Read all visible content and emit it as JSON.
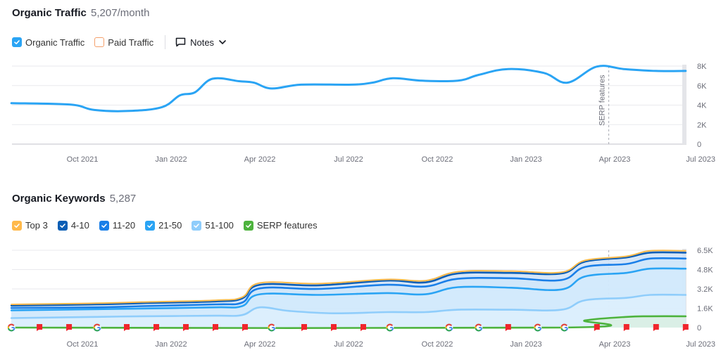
{
  "traffic": {
    "title": "Organic Traffic",
    "value": "5,207/month",
    "legend": [
      {
        "label": "Organic Traffic",
        "checked": true,
        "color": "#2aa4f4"
      },
      {
        "label": "Paid Traffic",
        "checked": false,
        "color": "#f4a06b"
      }
    ],
    "notes_label": "Notes"
  },
  "keywords": {
    "title": "Organic Keywords",
    "value": "5,287",
    "legend": [
      {
        "label": "Top 3",
        "checked": true,
        "color": "#ffb94a"
      },
      {
        "label": "4-10",
        "checked": true,
        "color": "#0b5eb5"
      },
      {
        "label": "11-20",
        "checked": true,
        "color": "#1a7fe8"
      },
      {
        "label": "21-50",
        "checked": true,
        "color": "#2aa4f4"
      },
      {
        "label": "51-100",
        "checked": true,
        "color": "#8fcdfb"
      },
      {
        "label": "SERP features",
        "checked": true,
        "color": "#4db33d"
      }
    ]
  },
  "chart_data": [
    {
      "type": "line",
      "title": "Organic Traffic",
      "x_ticks": [
        "Oct 2021",
        "Jan 2022",
        "Apr 2022",
        "Jul 2022",
        "Oct 2022",
        "Jan 2023",
        "Apr 2023",
        "Jul 2023"
      ],
      "x_range_months": [
        -2.4,
        20.4
      ],
      "y_ticks": [
        "0",
        "2K",
        "4K",
        "6K",
        "8K"
      ],
      "ylim": [
        0,
        8000
      ],
      "grid": true,
      "annotation": {
        "label": "SERP features",
        "month": 17.8
      },
      "series": [
        {
          "name": "Organic Traffic",
          "color": "#2aa4f4",
          "points": [
            [
              -2.4,
              4200
            ],
            [
              -0.4,
              4050
            ],
            [
              0.4,
              3500
            ],
            [
              1.6,
              3400
            ],
            [
              2.7,
              3800
            ],
            [
              3.3,
              5000
            ],
            [
              3.8,
              5300
            ],
            [
              4.4,
              6700
            ],
            [
              5.3,
              6450
            ],
            [
              5.8,
              6300
            ],
            [
              6.4,
              5700
            ],
            [
              7.4,
              6100
            ],
            [
              9.1,
              6100
            ],
            [
              9.8,
              6300
            ],
            [
              10.5,
              6750
            ],
            [
              11.5,
              6500
            ],
            [
              12.7,
              6500
            ],
            [
              13.4,
              7100
            ],
            [
              14.4,
              7700
            ],
            [
              15.6,
              7300
            ],
            [
              16.4,
              6300
            ],
            [
              17.4,
              7950
            ],
            [
              18.3,
              7700
            ],
            [
              19.4,
              7500
            ],
            [
              20.4,
              7500
            ]
          ]
        }
      ]
    },
    {
      "type": "area",
      "title": "Organic Keywords",
      "x_ticks": [
        "Oct 2021",
        "Jan 2022",
        "Apr 2022",
        "Jul 2022",
        "Oct 2022",
        "Jan 2023",
        "Apr 2023",
        "Jul 2023"
      ],
      "x_range_months": [
        -2.4,
        20.4
      ],
      "y_ticks": [
        "0",
        "1.6K",
        "3.2K",
        "4.8K",
        "6.5K"
      ],
      "ylim": [
        0,
        6500
      ],
      "grid": true,
      "series": [
        {
          "name": "Top 3",
          "color": "#ffb94a",
          "points": [
            [
              -2.4,
              1950
            ],
            [
              0.5,
              2050
            ],
            [
              2.0,
              2150
            ],
            [
              4.5,
              2300
            ],
            [
              5.4,
              2550
            ],
            [
              6.0,
              3750
            ],
            [
              8.0,
              3700
            ],
            [
              10.3,
              4050
            ],
            [
              11.6,
              3950
            ],
            [
              12.7,
              4700
            ],
            [
              14.5,
              4750
            ],
            [
              16.2,
              4650
            ],
            [
              17.0,
              5650
            ],
            [
              18.4,
              6000
            ],
            [
              19.2,
              6450
            ],
            [
              20.4,
              6450
            ]
          ]
        },
        {
          "name": "4-10",
          "color": "#0b5eb5",
          "points": [
            [
              -2.4,
              1850
            ],
            [
              0.5,
              1950
            ],
            [
              2.0,
              2050
            ],
            [
              4.5,
              2200
            ],
            [
              5.4,
              2450
            ],
            [
              6.0,
              3600
            ],
            [
              8.0,
              3550
            ],
            [
              10.3,
              3950
            ],
            [
              11.6,
              3800
            ],
            [
              12.7,
              4550
            ],
            [
              14.5,
              4600
            ],
            [
              16.2,
              4550
            ],
            [
              17.0,
              5550
            ],
            [
              18.4,
              5900
            ],
            [
              19.2,
              6300
            ],
            [
              20.4,
              6300
            ]
          ]
        },
        {
          "name": "11-20",
          "color": "#1a7fe8",
          "points": [
            [
              -2.4,
              1650
            ],
            [
              0.5,
              1700
            ],
            [
              2.0,
              1800
            ],
            [
              4.5,
              1950
            ],
            [
              5.4,
              2100
            ],
            [
              6.0,
              3300
            ],
            [
              8.0,
              3250
            ],
            [
              10.3,
              3600
            ],
            [
              11.6,
              3450
            ],
            [
              12.7,
              4100
            ],
            [
              14.5,
              4150
            ],
            [
              16.2,
              4000
            ],
            [
              17.0,
              5100
            ],
            [
              18.4,
              5350
            ],
            [
              19.2,
              5800
            ],
            [
              20.4,
              5800
            ]
          ]
        },
        {
          "name": "21-50",
          "color": "#2aa4f4",
          "points": [
            [
              -2.4,
              1450
            ],
            [
              0.5,
              1550
            ],
            [
              2.0,
              1600
            ],
            [
              4.5,
              1700
            ],
            [
              5.4,
              1800
            ],
            [
              6.0,
              2800
            ],
            [
              8.0,
              2750
            ],
            [
              10.3,
              2900
            ],
            [
              11.6,
              2800
            ],
            [
              12.7,
              3400
            ],
            [
              14.5,
              3350
            ],
            [
              16.2,
              3200
            ],
            [
              17.0,
              4300
            ],
            [
              18.4,
              4600
            ],
            [
              19.2,
              4950
            ],
            [
              20.4,
              4950
            ]
          ]
        },
        {
          "name": "51-100",
          "color": "#8fcdfb",
          "points": [
            [
              -2.4,
              800
            ],
            [
              0.5,
              900
            ],
            [
              2.0,
              950
            ],
            [
              4.5,
              1000
            ],
            [
              5.4,
              1050
            ],
            [
              6.0,
              1700
            ],
            [
              7.0,
              1400
            ],
            [
              8.5,
              1200
            ],
            [
              10.3,
              1300
            ],
            [
              11.6,
              1300
            ],
            [
              12.7,
              1500
            ],
            [
              14.5,
              1500
            ],
            [
              16.2,
              1500
            ],
            [
              17.0,
              2300
            ],
            [
              18.4,
              2500
            ],
            [
              19.2,
              2750
            ],
            [
              20.4,
              2750
            ]
          ]
        },
        {
          "name": "SERP features",
          "color": "#4db33d",
          "points": [
            [
              -2.4,
              0
            ],
            [
              16.2,
              0
            ],
            [
              17.0,
              600
            ],
            [
              18.4,
              900
            ],
            [
              19.2,
              950
            ],
            [
              20.4,
              950
            ]
          ]
        }
      ],
      "markers": {
        "google_updates_months": [
          -2.4,
          0.5,
          6.4,
          10.4,
          12.4,
          13.4,
          15.4,
          16.3
        ],
        "note_flags_months": [
          -1.45,
          -0.45,
          1.5,
          2.5,
          3.5,
          4.5,
          5.5,
          7.5,
          8.5,
          9.5,
          14.4,
          17.4,
          18.4,
          19.4,
          20.4
        ]
      }
    }
  ]
}
